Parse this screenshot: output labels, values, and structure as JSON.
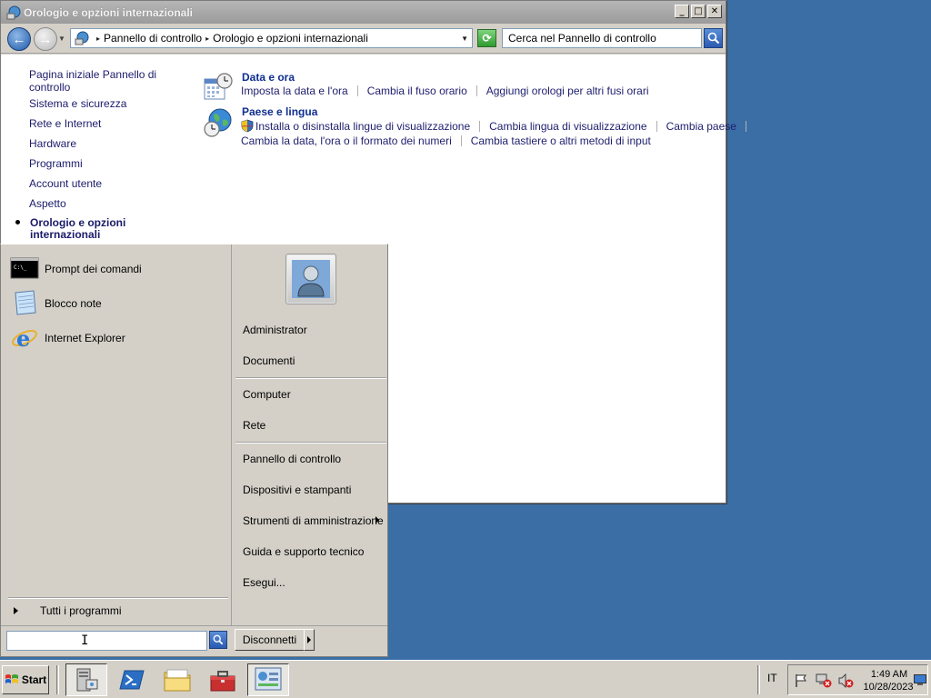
{
  "window": {
    "title": "Orologio e opzioni internazionali",
    "buttons": {
      "minimize": "_",
      "maximize": "□",
      "close": "✕"
    }
  },
  "addressbar": {
    "crumbs": [
      "Pannello di controllo",
      "Orologio e opzioni internazionali"
    ],
    "search_placeholder": "Cerca nel Pannello di controllo"
  },
  "sidebar": {
    "items": [
      {
        "label": "Pagina iniziale Pannello di controllo"
      },
      {
        "label": "Sistema e sicurezza"
      },
      {
        "label": "Rete e Internet"
      },
      {
        "label": "Hardware"
      },
      {
        "label": "Programmi"
      },
      {
        "label": "Account utente"
      },
      {
        "label": "Aspetto"
      }
    ],
    "current": "Orologio e opzioni internazionali"
  },
  "categories": [
    {
      "title": "Data e ora",
      "icon": "calendar-clock-icon",
      "links": [
        "Imposta la data e l'ora",
        "Cambia il fuso orario",
        "Aggiungi orologi per altri fusi orari"
      ]
    },
    {
      "title": "Paese e lingua",
      "icon": "globe-clock-icon",
      "links": [
        "Installa o disinstalla lingue di visualizzazione",
        "Cambia lingua di visualizzazione",
        "Cambia paese"
      ],
      "links2": [
        "Cambia la data, l'ora o il formato dei numeri",
        "Cambia tastiere o altri metodi di input"
      ]
    }
  ],
  "start_menu": {
    "pinned": [
      {
        "label": "Prompt dei comandi",
        "icon": "cmd-icon"
      },
      {
        "label": "Blocco note",
        "icon": "notepad-icon"
      },
      {
        "label": "Internet Explorer",
        "icon": "internet-explorer-icon"
      }
    ],
    "all_programs": "Tutti i programmi",
    "right": {
      "user": "Administrator",
      "documents": "Documenti",
      "computer": "Computer",
      "network": "Rete",
      "control_panel": "Pannello di controllo",
      "devices": "Dispositivi e stampanti",
      "admin_tools": "Strumenti di amministrazione",
      "help": "Guida e supporto tecnico",
      "run": "Esegui..."
    },
    "search_value": "",
    "logoff": "Disconnetti"
  },
  "taskbar": {
    "start_label": "Start",
    "apps": [
      "server-manager-icon",
      "powershell-icon",
      "explorer-folder-icon",
      "toolbox-icon",
      "control-panel-icon"
    ],
    "language": "IT",
    "time": "1:49 AM",
    "date": "10/28/2023"
  }
}
